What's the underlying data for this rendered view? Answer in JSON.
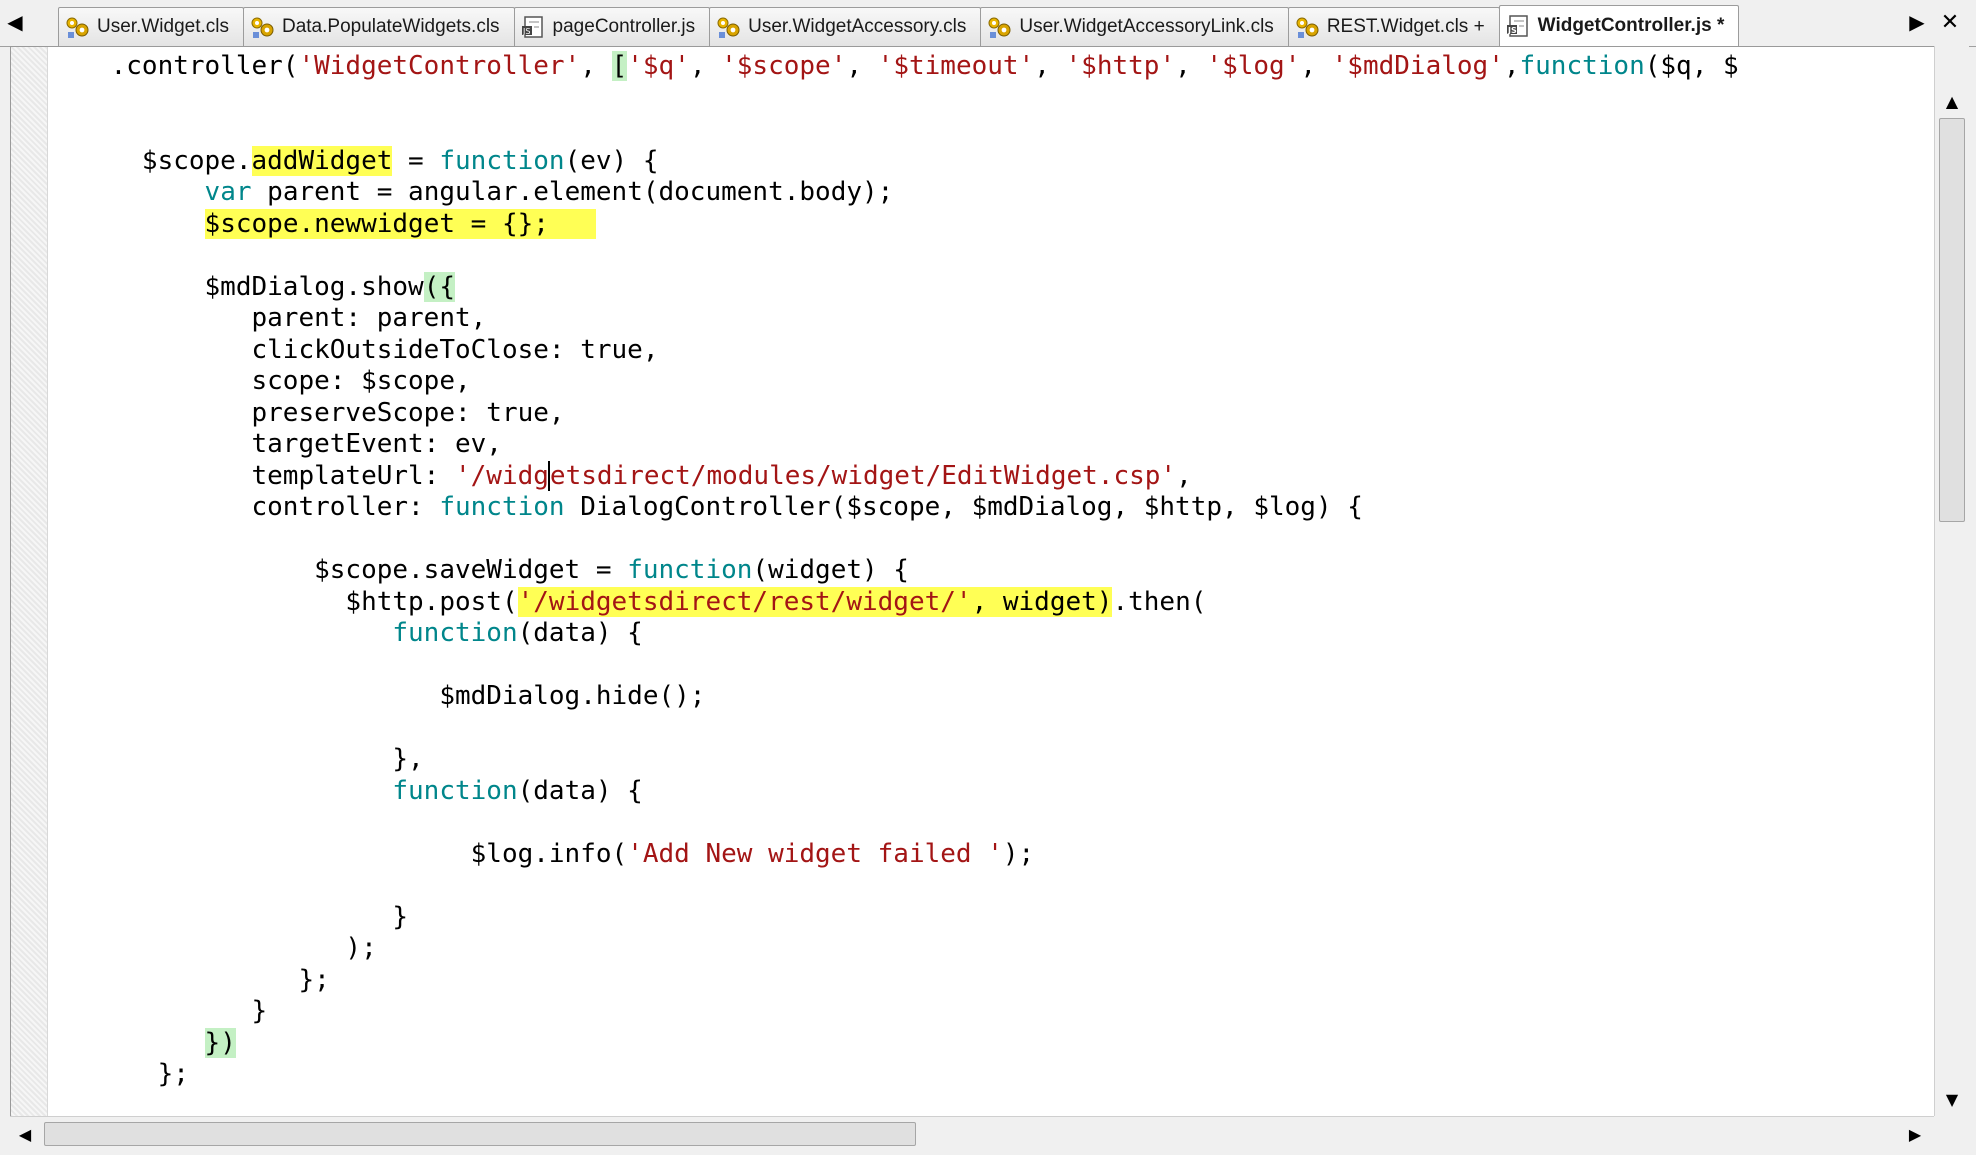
{
  "tabs": [
    {
      "label": "User.Widget.cls",
      "icon": "cls-file-icon"
    },
    {
      "label": "Data.PopulateWidgets.cls",
      "icon": "cls-file-icon"
    },
    {
      "label": "pageController.js",
      "icon": "js-file-icon"
    },
    {
      "label": "User.WidgetAccessory.cls",
      "icon": "cls-file-icon"
    },
    {
      "label": "User.WidgetAccessoryLink.cls",
      "icon": "cls-file-icon"
    },
    {
      "label": "REST.Widget.cls +",
      "icon": "cls-file-icon"
    },
    {
      "label": "WidgetController.js *",
      "icon": "js-file-icon",
      "active": true
    }
  ],
  "nav": {
    "left": "◀",
    "right": "▶",
    "close": "✕"
  },
  "scroll": {
    "up": "▲",
    "down": "▼",
    "left": "◀",
    "right": "▶"
  },
  "code_lines": [
    [
      {
        "t": "    .controller("
      },
      {
        "t": "'WidgetController'",
        "c": "str"
      },
      {
        "t": ", "
      },
      {
        "t": "[",
        "c": "hlg"
      },
      {
        "t": "'$q'",
        "c": "str"
      },
      {
        "t": ", "
      },
      {
        "t": "'$scope'",
        "c": "str"
      },
      {
        "t": ", "
      },
      {
        "t": "'$timeout'",
        "c": "str"
      },
      {
        "t": ", "
      },
      {
        "t": "'$http'",
        "c": "str"
      },
      {
        "t": ", "
      },
      {
        "t": "'$log'",
        "c": "str"
      },
      {
        "t": ", "
      },
      {
        "t": "'$mdDialog'",
        "c": "str"
      },
      {
        "t": ","
      },
      {
        "t": "function",
        "c": "kw"
      },
      {
        "t": "($q, $"
      }
    ],
    [],
    [],
    [
      {
        "t": "      $scope."
      },
      {
        "t": "addWidget",
        "c": "hl"
      },
      {
        "t": " = "
      },
      {
        "t": "function",
        "c": "kw"
      },
      {
        "t": "(ev) {"
      }
    ],
    [
      {
        "t": "          "
      },
      {
        "t": "var",
        "c": "kw"
      },
      {
        "t": " parent = angular.element(document.body);"
      }
    ],
    [
      {
        "t": "          "
      },
      {
        "t": "$scope.newwidget = {};   ",
        "c": "hl"
      }
    ],
    [],
    [
      {
        "t": "          $mdDialog.show"
      },
      {
        "t": "({",
        "c": "hlg"
      }
    ],
    [
      {
        "t": "             parent: parent,"
      }
    ],
    [
      {
        "t": "             clickOutsideToClose: true,"
      }
    ],
    [
      {
        "t": "             scope: $scope,"
      }
    ],
    [
      {
        "t": "             preserveScope: true,"
      }
    ],
    [
      {
        "t": "             targetEvent: ev,"
      }
    ],
    [
      {
        "t": "             templateUrl: "
      },
      {
        "t": "'/widg",
        "c": "str"
      },
      {
        "t": "",
        "c": "caret"
      },
      {
        "t": "etsdirect/modules/widget/EditWidget.csp'",
        "c": "str"
      },
      {
        "t": ","
      }
    ],
    [
      {
        "t": "             controller: "
      },
      {
        "t": "function",
        "c": "kw"
      },
      {
        "t": " DialogController($scope, $mdDialog, $http, $log) {"
      }
    ],
    [],
    [
      {
        "t": "                 $scope.saveWidget = "
      },
      {
        "t": "function",
        "c": "kw"
      },
      {
        "t": "(widget) {"
      }
    ],
    [
      {
        "t": "                   $http.post("
      },
      {
        "t": "'/widgetsdirect/rest/widget/'",
        "c": "hl str"
      },
      {
        "t": ", widget)",
        "c": "hl"
      },
      {
        "t": ".then("
      }
    ],
    [
      {
        "t": "                      "
      },
      {
        "t": "function",
        "c": "kw"
      },
      {
        "t": "(data) {"
      }
    ],
    [],
    [
      {
        "t": "                         $mdDialog.hide();"
      }
    ],
    [],
    [
      {
        "t": "                      },"
      }
    ],
    [
      {
        "t": "                      "
      },
      {
        "t": "function",
        "c": "kw"
      },
      {
        "t": "(data) {"
      }
    ],
    [],
    [
      {
        "t": "                           $log.info("
      },
      {
        "t": "'Add New widget failed '",
        "c": "str"
      },
      {
        "t": ");"
      }
    ],
    [],
    [
      {
        "t": "                      }"
      }
    ],
    [
      {
        "t": "                   );"
      }
    ],
    [
      {
        "t": "                };"
      }
    ],
    [
      {
        "t": "             }"
      }
    ],
    [
      {
        "t": "          "
      },
      {
        "t": "})",
        "c": "hlg"
      }
    ],
    [
      {
        "t": "       };"
      }
    ]
  ]
}
